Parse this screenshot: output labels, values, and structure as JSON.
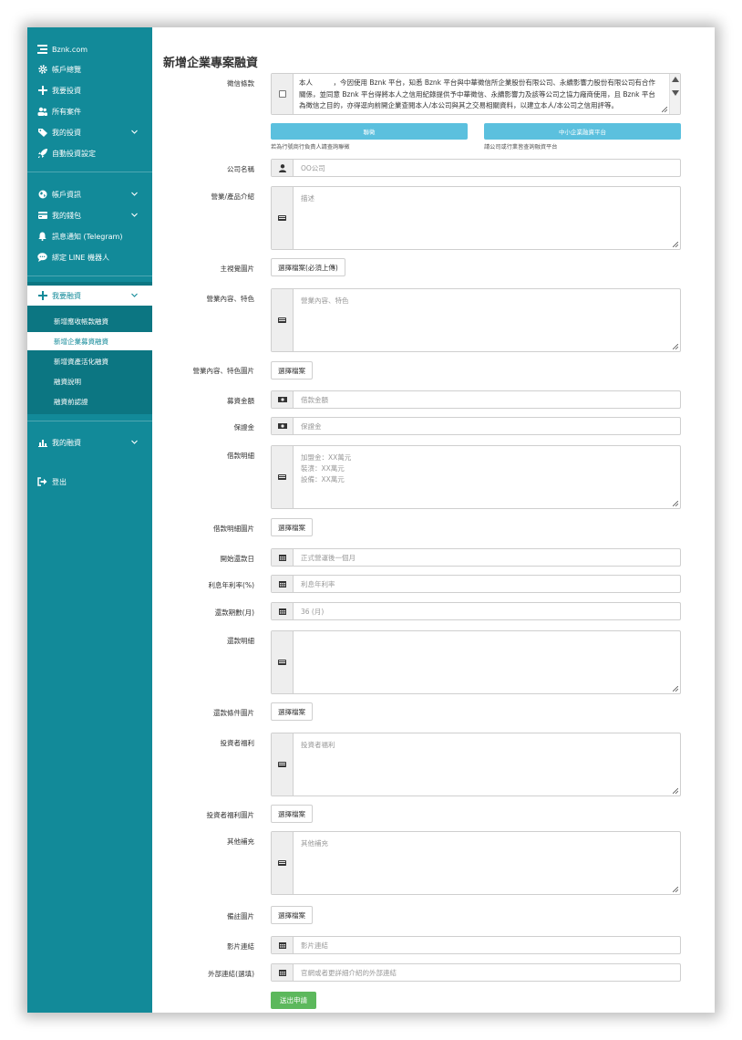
{
  "sidebar": {
    "brand": "Bznk.com",
    "items": [
      {
        "label": "帳戶總覽",
        "icon": "gear-icon"
      },
      {
        "label": "我要投資",
        "icon": "plus-icon"
      },
      {
        "label": "所有案件",
        "icon": "users-icon"
      },
      {
        "label": "我的投資",
        "icon": "tag-icon"
      },
      {
        "label": "自動投資設定",
        "icon": "rocket-icon"
      },
      {
        "label": "帳戶資訊",
        "icon": "globe-icon"
      },
      {
        "label": "我的錢包",
        "icon": "card-icon"
      },
      {
        "label": "訊息通知 (Telegram)",
        "icon": "bell-icon"
      },
      {
        "label": "綁定 LINE 機器人",
        "icon": "chat-icon"
      }
    ],
    "financing": {
      "label": "我要融資",
      "sub": [
        "新增應收帳款融資",
        "新增企業募資融資",
        "新增資產活化融資",
        "融資說明",
        "融資前認證"
      ]
    },
    "my_financing": "我的融資",
    "logout": "登出"
  },
  "main": {
    "title": "新增企業專案融資",
    "consent": {
      "label": "徵信條款",
      "text": "本人　　　，今因使用 Bznk 平台，知悉 Bznk 平台與中華徵信所企業股份有限公司、永續影響力股份有限公司有合作關係，並同意 Bznk 平台得將本人之信用紀錄提供予中華徵信、永續影響力及該等公司之協力廠商使用，且 Bznk 平台為徵信之目的，亦得逕向前開企業查閱本人/本公司與其之交易相關資料，以建立本人/本公司之信用評等。"
    },
    "btn_contact": "聯徵",
    "btn_sme": "中小企業融資平台",
    "hint_contact": "若為行號商行負責人請查詢聯徵",
    "hint_sme": "請公司或行業皆查詢融資平台",
    "company": {
      "label": "公司名稱",
      "placeholder": "OO公司"
    },
    "intro": {
      "label": "營業/產品介紹",
      "placeholder": "描述"
    },
    "main_image": {
      "label": "主視覺圖片",
      "button": "選擇檔案(必須上傳)"
    },
    "features": {
      "label": "營業內容、特色",
      "placeholder": "營業內容、特色"
    },
    "features_image": {
      "label": "營業內容、特色圖片",
      "button": "選擇檔案"
    },
    "amount": {
      "label": "募資金額",
      "placeholder": "借款金額"
    },
    "deposit": {
      "label": "保證金",
      "placeholder": "保證金"
    },
    "loan_detail": {
      "label": "借款明細",
      "placeholder": "加盟金：XX萬元\n裝潢：XX萬元\n設備：XX萬元"
    },
    "loan_detail_image": {
      "label": "借款明細圖片",
      "button": "選擇檔案"
    },
    "repay_start": {
      "label": "開始還款日",
      "placeholder": "正式營運後一個月"
    },
    "rate": {
      "label": "利息年利率(%)",
      "placeholder": "利息年利率"
    },
    "terms": {
      "label": "還款期數(月)",
      "placeholder": "36 (月)"
    },
    "repay_detail": {
      "label": "還款明細",
      "placeholder": ""
    },
    "repay_image": {
      "label": "還款條件圖片",
      "button": "選擇檔案"
    },
    "benefit": {
      "label": "投資者福利",
      "placeholder": "投資者福利"
    },
    "benefit_image": {
      "label": "投資者福利圖片",
      "button": "選擇檔案"
    },
    "other": {
      "label": "其他補充",
      "placeholder": "其他補充"
    },
    "note_image": {
      "label": "備註圖片",
      "button": "選擇檔案"
    },
    "video": {
      "label": "影片連結",
      "placeholder": "影片連結"
    },
    "external": {
      "label": "外部連結(選填)",
      "placeholder": "官網或者更詳細介紹的外部連結"
    },
    "submit": "送出申請"
  },
  "colors": {
    "sidebar": "#128a99",
    "sidebar_dark": "#0c7682",
    "info": "#5bc0de",
    "success": "#5cb85c"
  }
}
